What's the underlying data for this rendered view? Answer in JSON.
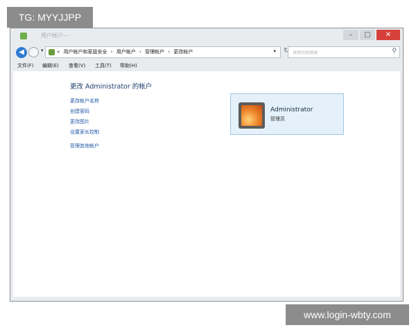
{
  "watermarks": {
    "top": "TG: MYYJJPP",
    "bottom": "www.login-wbty.com"
  },
  "window": {
    "title": "用户帐户—",
    "close_glyph": "✕",
    "min_glyph": "–",
    "max_glyph": "□"
  },
  "address": {
    "crumbs": [
      "«",
      "用户帐户和家庭安全",
      "›",
      "用户帐户",
      "›",
      "管理帐户",
      "›",
      "更改帐户"
    ],
    "dropdown_glyph": "▾",
    "refresh_glyph": "↻",
    "search_placeholder": "搜索控制面板"
  },
  "menu": [
    "文件(F)",
    "编辑(E)",
    "查看(V)",
    "工具(T)",
    "帮助(H)"
  ],
  "content": {
    "heading": "更改 Administrator 的帐户",
    "links": [
      "更改帐户名称",
      "创建密码",
      "更改图片",
      "设置家长控制",
      "管理其他帐户"
    ]
  },
  "account": {
    "name": "Administrator",
    "role": "管理员"
  },
  "icons": {
    "back": "arrow-left-icon",
    "forward": "arrow-right-icon",
    "search": "magnifier-icon",
    "refresh": "refresh-icon"
  }
}
